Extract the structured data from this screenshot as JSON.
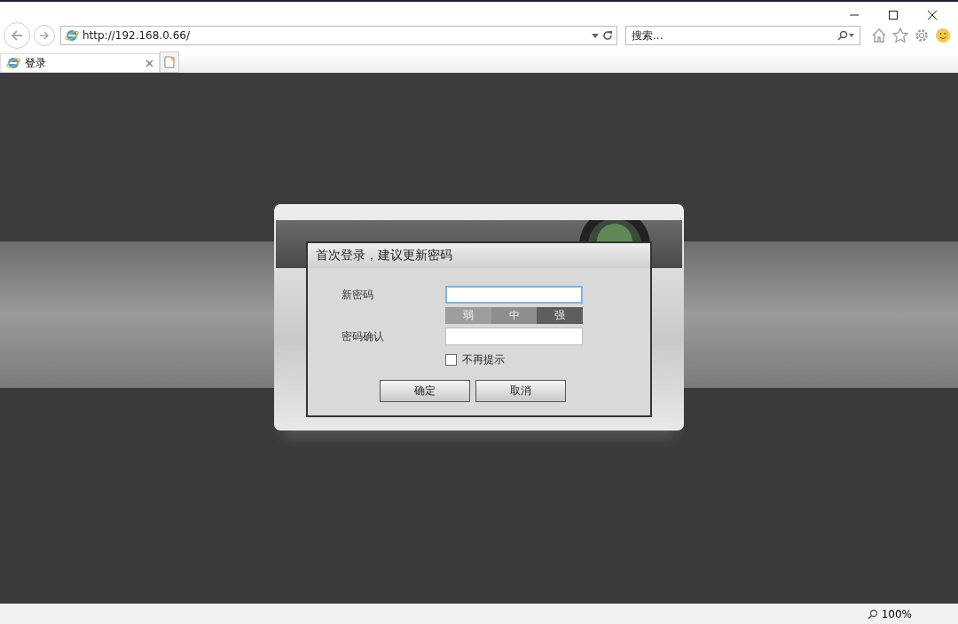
{
  "browser": {
    "address": "http://192.168.0.66/",
    "search_placeholder": "搜索...",
    "tabs": [
      {
        "label": "登录",
        "selected": true
      }
    ]
  },
  "dialog": {
    "title": "首次登录，建议更新密码",
    "fields": [
      {
        "label": "新密码",
        "focused": true
      },
      {
        "label": "密码确认",
        "focused": false
      }
    ],
    "strength": [
      {
        "label": "弱",
        "selected": false
      },
      {
        "label": "中",
        "selected": false
      },
      {
        "label": "强",
        "selected": true
      }
    ],
    "dont_remind": {
      "label": "不再提示",
      "checked": false
    },
    "buttons": [
      "确定",
      "取消"
    ]
  },
  "status_bar": {
    "zoom": "100%"
  }
}
